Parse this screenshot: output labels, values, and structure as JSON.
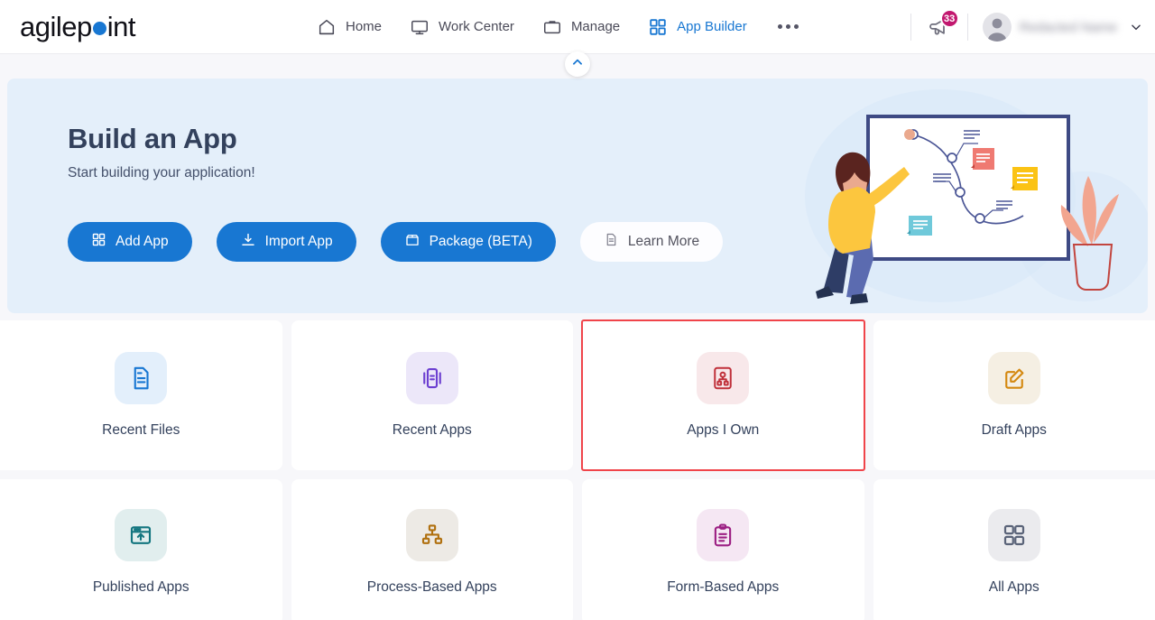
{
  "brand": {
    "name_part1": "agilep",
    "name_part2": "int",
    "dot_color": "#1877d2"
  },
  "header": {
    "nav": [
      {
        "label": "Home",
        "icon": "home-icon",
        "active": false
      },
      {
        "label": "Work Center",
        "icon": "monitor-icon",
        "active": false
      },
      {
        "label": "Manage",
        "icon": "briefcase-icon",
        "active": false
      },
      {
        "label": "App Builder",
        "icon": "grid-icon",
        "active": true
      }
    ],
    "more_menu": "...",
    "announcements": {
      "icon": "megaphone-icon",
      "badge_count": "33",
      "badge_color": "#c2186f"
    },
    "user": {
      "name": "",
      "avatar_icon": "user-avatar-icon",
      "chevron": "chevron-down-icon"
    }
  },
  "collapse_button": {
    "icon": "chevron-up-icon",
    "color": "#1877d2"
  },
  "banner": {
    "title": "Build an App",
    "subtitle": "Start building your application!",
    "buttons": [
      {
        "label": "Add App",
        "icon": "grid-icon",
        "style": "primary"
      },
      {
        "label": "Import App",
        "icon": "download-icon",
        "style": "primary"
      },
      {
        "label": "Package (BETA)",
        "icon": "package-icon",
        "style": "primary"
      },
      {
        "label": "Learn More",
        "icon": "document-icon",
        "style": "light"
      }
    ],
    "illustration": "woman-drawing-flowchart-on-whiteboard"
  },
  "cards": [
    {
      "label": "Recent Files",
      "icon": "file-document-icon",
      "icon_color": "#1877d2",
      "icon_bg": "#e3effb",
      "highlighted": false
    },
    {
      "label": "Recent Apps",
      "icon": "recent-apps-icon",
      "icon_color": "#6c3fd1",
      "icon_bg": "#ece7f9",
      "highlighted": false
    },
    {
      "label": "Apps I Own",
      "icon": "org-chart-icon",
      "icon_color": "#c0303a",
      "icon_bg": "#f8e8ea",
      "highlighted": true
    },
    {
      "label": "Draft Apps",
      "icon": "edit-square-icon",
      "icon_color": "#d4880f",
      "icon_bg": "#f5efe3",
      "highlighted": false
    },
    {
      "label": "Published Apps",
      "icon": "publish-window-icon",
      "icon_color": "#12757f",
      "icon_bg": "#e1eeee",
      "highlighted": false
    },
    {
      "label": "Process-Based Apps",
      "icon": "sitemap-icon",
      "icon_color": "#b0700f",
      "icon_bg": "#edeae5",
      "highlighted": false
    },
    {
      "label": "Form-Based Apps",
      "icon": "clipboard-icon",
      "icon_color": "#9c1f83",
      "icon_bg": "#f5e7f3",
      "highlighted": false
    },
    {
      "label": "All Apps",
      "icon": "grid-squares-icon",
      "icon_color": "#5b6479",
      "icon_bg": "#ebebee",
      "highlighted": false
    }
  ]
}
